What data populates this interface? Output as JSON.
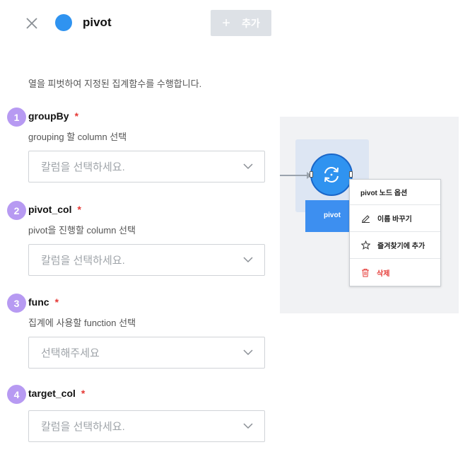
{
  "header": {
    "title": "pivot",
    "add_label": "추가",
    "node_color": "#2f93f0"
  },
  "description": "열을 피벗하여 지정된 집계함수를 수행합니다.",
  "fields": [
    {
      "number": "1",
      "label": "groupBy",
      "required": "*",
      "hint": "grouping 할 column 선택",
      "placeholder": "칼럼을 선택하세요."
    },
    {
      "number": "2",
      "label": "pivot_col",
      "required": "*",
      "hint": "pivot을 진행할 column 선택",
      "placeholder": "칼럼을 선택하세요."
    },
    {
      "number": "3",
      "label": "func",
      "required": "*",
      "hint": "집계에 사용할 function 선택",
      "placeholder": "선택해주세요"
    },
    {
      "number": "4",
      "label": "target_col",
      "required": "*",
      "placeholder": "칼럼을 선택하세요."
    }
  ],
  "preview": {
    "node_label": "pivot",
    "menu": {
      "header": "pivot 노드 옵션",
      "items": [
        {
          "label": "이름 바꾸기",
          "icon": "pencil-icon"
        },
        {
          "label": "즐겨찾기에 추가",
          "icon": "star-icon"
        },
        {
          "label": "삭제",
          "icon": "trash-icon",
          "color": "#e53935"
        }
      ]
    }
  }
}
